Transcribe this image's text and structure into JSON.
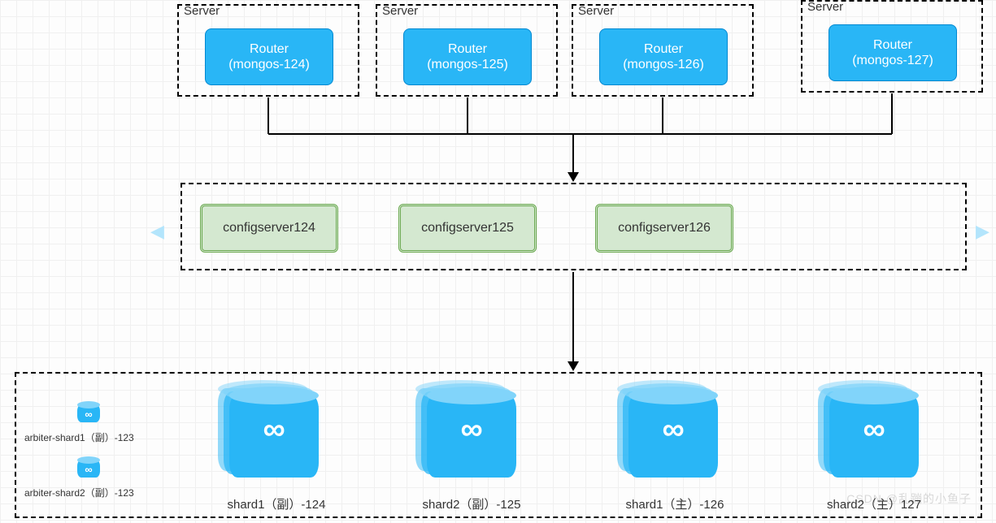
{
  "routers": [
    {
      "server_label": "Server",
      "title": "Router",
      "sub": "(mongos-124)"
    },
    {
      "server_label": "Server",
      "title": "Router",
      "sub": "(mongos-125)"
    },
    {
      "server_label": "Server",
      "title": "Router",
      "sub": "(mongos-126)"
    },
    {
      "server_label": "Server",
      "title": "Router",
      "sub": "(mongos-127)"
    }
  ],
  "configservers": [
    "configserver124",
    "configserver125",
    "configserver126"
  ],
  "arbiters": [
    "arbiter-shard1（副）-123",
    "arbiter-shard2（副）-123"
  ],
  "shards": [
    "shard1（副）-124",
    "shard2（副）-125",
    "shard1（主）-126",
    "shard2（主）127"
  ],
  "watermark": "CSDN @乱蹦的小鱼子"
}
